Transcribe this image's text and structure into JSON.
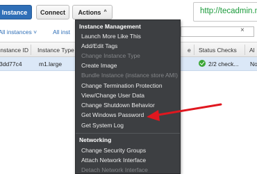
{
  "toolbar": {
    "launch_label": "Instance",
    "connect_label": "Connect",
    "actions_label": "Actions",
    "actions_caret": "^"
  },
  "browser": {
    "url_text": "http://tecadmin.n"
  },
  "filters": {
    "filter1_label": "All instances",
    "filter1_caret": "˅",
    "filter2_label": "All inst",
    "clear_icon": "×"
  },
  "table": {
    "columns": [
      "Instance ID",
      "Instance Type",
      "e",
      "Status Checks",
      "Al"
    ],
    "rows": [
      {
        "instance_id": "3dd77c4",
        "instance_type": "m1.large",
        "status_checks": "2/2 check...",
        "alarm": "No"
      }
    ]
  },
  "menu": {
    "section1": {
      "header": "Instance Management",
      "items": [
        {
          "label": "Launch More Like This",
          "disabled": false
        },
        {
          "label": "Add/Edit Tags",
          "disabled": false
        },
        {
          "label": "Change Instance Type",
          "disabled": true
        },
        {
          "label": "Create Image",
          "disabled": false
        },
        {
          "label": "Bundle Instance (instance store AMI)",
          "disabled": true
        },
        {
          "label": "Change Termination Protection",
          "disabled": false
        },
        {
          "label": "View/Change User Data",
          "disabled": false
        },
        {
          "label": "Change Shutdown Behavior",
          "disabled": false
        },
        {
          "label": "Get Windows Password",
          "disabled": false
        },
        {
          "label": "Get System Log",
          "disabled": false
        }
      ]
    },
    "section2": {
      "header": "Networking",
      "items": [
        {
          "label": "Change Security Groups",
          "disabled": false
        },
        {
          "label": "Attach Network Interface",
          "disabled": false
        },
        {
          "label": "Detach Network Interface",
          "disabled": true
        }
      ]
    }
  },
  "colors": {
    "primary": "#2f6fb7",
    "menu_bg": "#3d3f42",
    "arrow": "#e0171f",
    "status_ok": "#3aa535",
    "url_green": "#1a9a3a"
  },
  "icons": {
    "status": "check-circle-icon",
    "arrow": "red-arrow-annotation",
    "clear": "close-icon"
  }
}
